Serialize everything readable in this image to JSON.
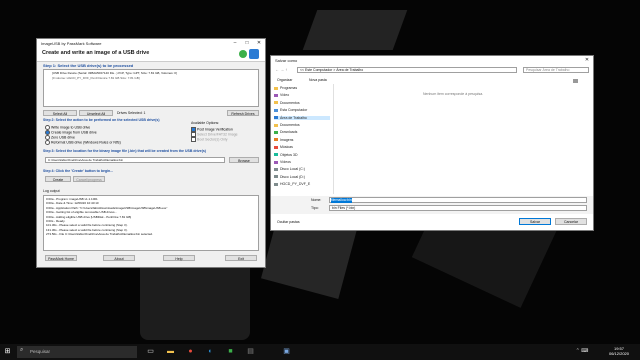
{
  "usb_app": {
    "title": "ImageUSB by PassMark Software",
    "header": "Create and write an image of a USB drive",
    "step1": "Step 1: Select the USB drive(s) to be processed",
    "drive_line1": "[USB Drive Device (Serial: 33B2A5F07140 Dis...) PnP, Type: GPT, Size: 7.81 GB, Volumes: 0]",
    "drive_line2": "[0 volume: HGCD_PY_DVF_Pen0 Device 7.81 GB Size: 7.81 GB]",
    "select_all": "Select All",
    "unselect_all": "Unselect All",
    "drives_selected": "Drives Selected: 1",
    "refresh": "Refresh Drives",
    "step2": "Step 2: Select the action to be performed on the selected USB drive(s)",
    "actions": [
      "Write image to USB drive",
      "Create image from USB drive",
      "Zero USB drive",
      "Reformat USB drive (Windows Rules or Ntfs)"
    ],
    "options_title": "Available Options:",
    "options": [
      "Post Image Verification",
      "Select Drive/FAT32 Image",
      "Boot Sector(s) Only"
    ],
    "step3": "Step 3: Select the location for the binary image file (.bin) that will be created from the USB drive(s)",
    "path": "C:\\Users\\fabio\\OneDrive\\Area de Trabalho\\filemallow.bin",
    "browse": "Browse",
    "step4": "Step 4: Click the 'Create' button to begin...",
    "create": "Create",
    "cancel": "Cancel/progress",
    "log_label": "Log output",
    "log": [
      "0:00a - Program: imageUSB v1.1.1001",
      "0:00a - Date & Time: 12/09/20 10:40:10",
      "0:00a - Application Path: \"C:\\Users\\fabio\\Downloads\\imageUSB\\imageUSB\\imageUSB.exe\"",
      "0:00a - Getting list of eligible removable USB drives...",
      "0:00a -    Adding eligible USB drive [USBDisk - PenDrive    7.81 GB]",
      "0:00s - Ready.",
      "101.30s - Please select a valid file before continuing (Step 3).",
      "131.30s - Please select a valid file before continuing (Step 3).",
      "273.50s - File C:\\Users\\fabio\\OneDrive\\Area de Trabalho\\filemallow.bin selected."
    ],
    "footer": [
      "PassMark Home",
      "About",
      "Help",
      "Exit"
    ]
  },
  "save_dialog": {
    "title": "Salvar como",
    "breadcrumb": "<< Este Computador > Área de Trabalho",
    "search_placeholder": "Pesquisar Área de Trabalho",
    "organize": "Organizar",
    "new_folder": "Nova pasta",
    "empty": "Nenhum item corresponde à pesquisa.",
    "nav": [
      "Programas",
      "Vídeo",
      "Documentos",
      "Esta Computador",
      "Área de Trabalho",
      "Documentos",
      "Downloads",
      "Imagens",
      "Músicas",
      "Objetos 3D",
      "Vídeos",
      "Disco Local (C:)",
      "Disco Local (D:)",
      "HGCD_PY_DVF_E"
    ],
    "name_label": "Nome:",
    "name_value": "filemallow.bin",
    "type_label": "Tipo:",
    "type_value": "bin Files (*.bin)",
    "hide_folders": "Ocultar pastas",
    "save": "Salvar",
    "cancel": "Cancelar"
  },
  "taskbar": {
    "search": "Pesquisar",
    "time": "19:57",
    "date": "06/12/2020"
  }
}
